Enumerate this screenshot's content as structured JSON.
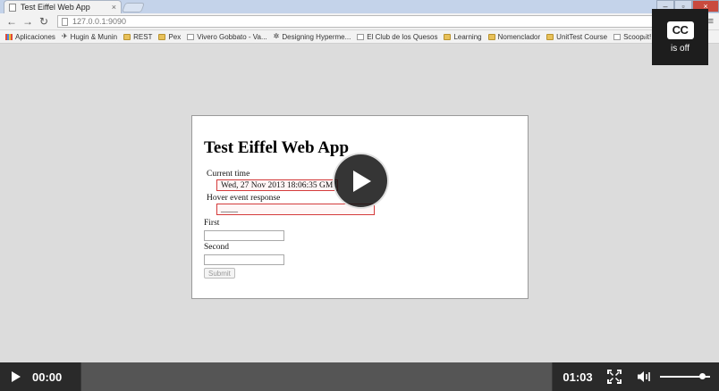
{
  "browser": {
    "tab_title": "Test Eiffel Web App",
    "tab_close": "×",
    "url": "127.0.0.1:9090",
    "bookmarks": [
      {
        "label": "Aplicaciones",
        "icon": "apps-grid-icon"
      },
      {
        "label": "Hugin & Munin",
        "icon": "bird-icon"
      },
      {
        "label": "REST",
        "icon": "folder-icon"
      },
      {
        "label": "Pex",
        "icon": "folder-icon"
      },
      {
        "label": "Vivero Gobbato - Va...",
        "icon": "page-icon"
      },
      {
        "label": "Designing Hyperme...",
        "icon": "gear-icon"
      },
      {
        "label": "El Club de los Quesos",
        "icon": "page-icon"
      },
      {
        "label": "Learning",
        "icon": "folder-icon"
      },
      {
        "label": "Nomenclador",
        "icon": "folder-icon"
      },
      {
        "label": "UnitTest Course",
        "icon": "folder-icon"
      },
      {
        "label": "Scoop.it!",
        "icon": "page-icon"
      }
    ],
    "bookmarks_overflow": "»"
  },
  "app": {
    "title": "Test Eiffel Web App",
    "current_time_label": "Current time",
    "current_time_value": "Wed, 27 Nov 2013 18:06:35 GMT",
    "hover_label": "Hover event response",
    "hover_value": "____",
    "first_label": "First",
    "first_value": "",
    "second_label": "Second",
    "second_value": "",
    "submit_label": "Submit"
  },
  "player": {
    "cc_icon_text": "CC",
    "cc_status": "is off",
    "current_time": "00:00",
    "duration": "01:03",
    "volume_level": 0.85,
    "colors": {
      "controls_bg": "#2a2a2a",
      "scrubber_bg": "#555555",
      "overlay_bg": "#1d1d1d"
    }
  }
}
